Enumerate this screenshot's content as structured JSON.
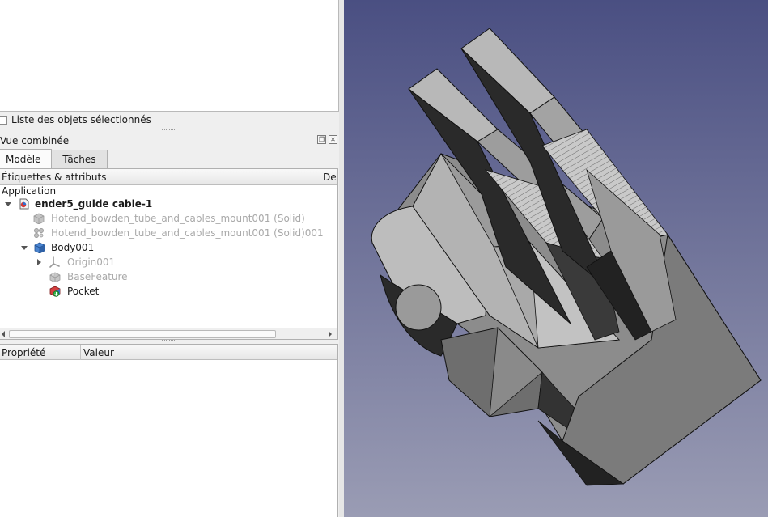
{
  "selection_panel": {
    "checkbox_label": "Liste des objets sélectionnés"
  },
  "combo_view": {
    "title": "Vue combinée",
    "tabs": [
      {
        "label": "Modèle",
        "active": true
      },
      {
        "label": "Tâches",
        "active": false
      }
    ]
  },
  "tree": {
    "headers": [
      "Étiquettes & attributs",
      "Des"
    ],
    "root_label": "Application",
    "items": [
      {
        "label": "ender5_guide cable-1",
        "icon": "document-icon",
        "expanded": true,
        "bold": true
      },
      {
        "label": "Hotend_bowden_tube_and_cables_mount001 (Solid)",
        "icon": "solid-icon",
        "greyed": true
      },
      {
        "label": "Hotend_bowden_tube_and_cables_mount001 (Solid)001",
        "icon": "mesh-icon",
        "greyed": true
      },
      {
        "label": "Body001",
        "icon": "body-icon",
        "expanded": true
      },
      {
        "label": "Origin001",
        "icon": "origin-icon",
        "greyed": true,
        "collapsed": true
      },
      {
        "label": "BaseFeature",
        "icon": "base-feature-icon",
        "greyed": true
      },
      {
        "label": "Pocket",
        "icon": "pocket-icon"
      }
    ]
  },
  "properties": {
    "headers": [
      "Propriété",
      "Valeur"
    ]
  },
  "viewport": {
    "bg_top": "#4a4f82",
    "bg_bottom": "#9a9cb4",
    "model_fill": "#a8a8a8"
  }
}
